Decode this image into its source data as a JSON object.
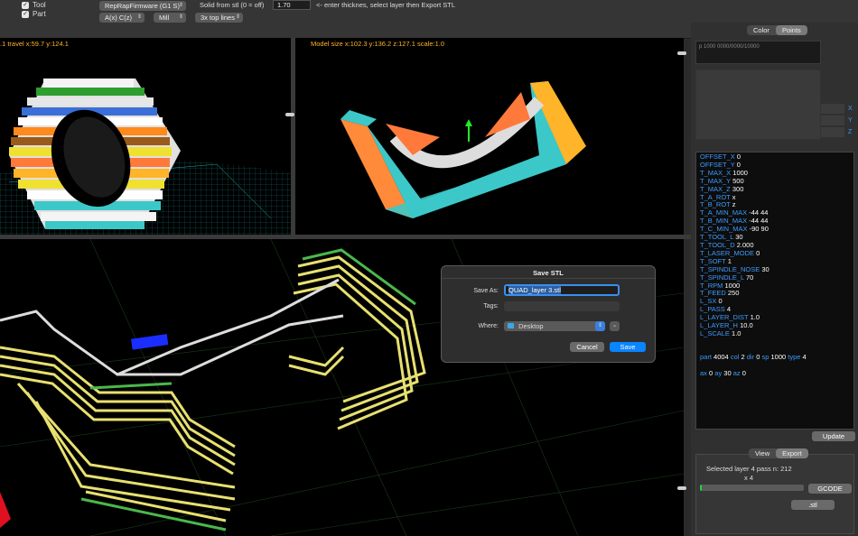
{
  "topbar": {
    "tool_checkbox": {
      "label": "Tool",
      "checked": true
    },
    "part_checkbox": {
      "label": "Part",
      "checked": true
    },
    "firmware_select": "RepRapFirmware (G1 S)",
    "axis_select": "A(x) C(z)",
    "mode_select": "Mill",
    "lines_select": "3x top lines",
    "solid_label": "Solid from stl (0 = off)",
    "thickness_value": "1.70",
    "hint": "<- enter thicknes, select layer then Export STL"
  },
  "viewports": {
    "top_left_label": ".1 travel x:59.7 y:124.1",
    "top_right_label": "Model size x:102.3 y:136.2 z:127.1  scale:1.0"
  },
  "right_panel": {
    "tabs": [
      "Color",
      "Points"
    ],
    "selected_tab": "Points",
    "points_text": "p 1000 0000/0000/10000",
    "axis_labels": [
      "X",
      "Y",
      "Z"
    ],
    "params": [
      {
        "key": "OFFSET_X",
        "value": "0"
      },
      {
        "key": "OFFSET_Y",
        "value": "0"
      },
      {
        "key": "T_MAX_X",
        "value": "1000"
      },
      {
        "key": "T_MAX_Y",
        "value": "500"
      },
      {
        "key": "T_MAX_Z",
        "value": "300"
      },
      {
        "key": "T_A_ROT",
        "value": "x"
      },
      {
        "key": "T_B_ROT",
        "value": "z"
      },
      {
        "key": "T_A_MIN_MAX",
        "value": "-44 44"
      },
      {
        "key": "T_B_MIN_MAX",
        "value": "-44 44"
      },
      {
        "key": "T_C_MIN_MAX",
        "value": "-90 90"
      },
      {
        "key": "T_TOOL_L",
        "value": "30"
      },
      {
        "key": "T_TOOL_D",
        "value": "2.000"
      },
      {
        "key": "T_LASER_MODE",
        "value": "0"
      },
      {
        "key": "T_SOFT",
        "value": "1"
      },
      {
        "key": "T_SPINDLE_NOSE",
        "value": "30"
      },
      {
        "key": "T_SPINDLE_L",
        "value": "70"
      },
      {
        "key": "T_RPM",
        "value": "1000"
      },
      {
        "key": "T_FEED",
        "value": "250"
      },
      {
        "key": "L_SX",
        "value": "0"
      },
      {
        "key": "L_PASS",
        "value": "4"
      },
      {
        "key": "L_LAYER_DIST",
        "value": "1.0"
      },
      {
        "key": "L_LAYER_H",
        "value": "10.0"
      },
      {
        "key": "L_SCALE",
        "value": "1.0"
      }
    ],
    "status1": [
      {
        "k": "part",
        "v": "4004"
      },
      {
        "k": "col",
        "v": "2"
      },
      {
        "k": "dir",
        "v": "0"
      },
      {
        "k": "sp",
        "v": "1000"
      },
      {
        "k": "type",
        "v": "4"
      }
    ],
    "status2": [
      {
        "k": "ax",
        "v": "0"
      },
      {
        "k": "ay",
        "v": "30"
      },
      {
        "k": "az",
        "v": "0"
      }
    ],
    "update_button": "Update",
    "bottom_tabs": [
      "View",
      "Export"
    ],
    "bottom_selected": "Export",
    "selected_layer_text": "Selected layer 4 pass n: 212",
    "multiplier_text": "x 4",
    "progress_fraction": 0.02,
    "gcode_button": "GCODE",
    "stl_button": ".stl"
  },
  "dialog": {
    "title": "Save STL",
    "save_as_label": "Save As:",
    "filename": "QUAD_layer 3.stl",
    "tags_label": "Tags:",
    "where_label": "Where:",
    "where_value": "Desktop",
    "cancel_button": "Cancel",
    "save_button": "Save"
  },
  "colors": {
    "accent": "#0a84ff",
    "label_orange": "#ffb429",
    "param_key": "#3d9bff",
    "path_yellow": "#e8e070",
    "path_green": "#4ab84a",
    "model_cyan": "#3cc8c8",
    "model_orange": "#ff7a3a"
  }
}
